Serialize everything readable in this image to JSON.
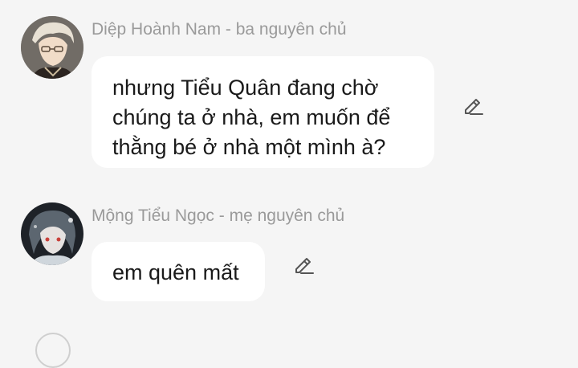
{
  "messages": [
    {
      "sender": "Diệp Hoành Nam - ba nguyên chủ",
      "lines": [
        "nhưng Tiểu Quân đang chờ",
        "chúng ta ở nhà, em muốn để",
        "thằng bé ở nhà một mình à?"
      ],
      "edit_icon": "pencil-icon"
    },
    {
      "sender": "Mộng Tiểu Ngọc - mẹ nguyên chủ",
      "lines": [
        "em quên mất"
      ],
      "edit_icon": "pencil-icon"
    }
  ],
  "colors": {
    "background": "#f5f5f5",
    "bubble": "#ffffff",
    "sender_text": "#9a9a9a",
    "message_text": "#1a1a1a",
    "icon": "#555555"
  }
}
